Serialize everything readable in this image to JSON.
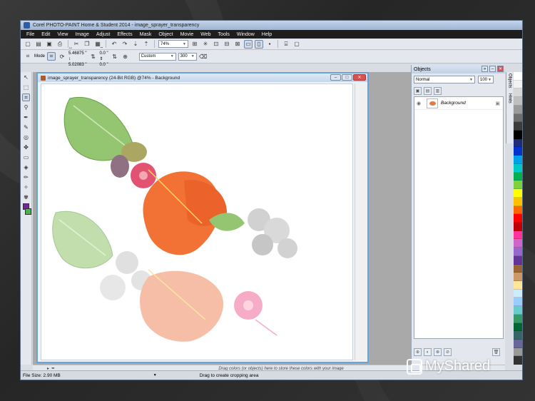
{
  "window": {
    "title": "Corel PHOTO-PAINT Home & Student 2014 - image_sprayer_transparency"
  },
  "menu": [
    "File",
    "Edit",
    "View",
    "Image",
    "Adjust",
    "Effects",
    "Mask",
    "Object",
    "Movie",
    "Web",
    "Tools",
    "Window",
    "Help"
  ],
  "toolbar": {
    "zoom": "74%"
  },
  "property_bar": {
    "mode_label": "Mode",
    "width": "5.46875 \"",
    "height": "5.02083 \"",
    "offset_x": "0.0 \"",
    "offset_y": "0.0 \"",
    "preset": "Custom",
    "resolution": "300"
  },
  "document": {
    "title": "image_sprayer_transparency (24-Bit RGB) @74% - Background"
  },
  "objects_panel": {
    "title": "Objects",
    "blend_mode": "Normal",
    "opacity": "100",
    "items": [
      {
        "name": "Background"
      }
    ]
  },
  "docker_tabs": [
    "Objects",
    "Hints"
  ],
  "color_bar": {
    "hint": "Drag colors (or objects) here to store these colors with your image"
  },
  "status": {
    "file_size": "File Size: 2.90 MB",
    "message": "Drag to create cropping area"
  },
  "watermark": {
    "text": "MyShared"
  },
  "colors": {
    "foreground": "#7a1fa2",
    "background": "#4caf50",
    "palette": [
      "#ffffff",
      "#f2f2f2",
      "#d8d8d8",
      "#bfbfbf",
      "#9a9a9a",
      "#6e6e6e",
      "#3c3c3c",
      "#000000",
      "#1f2a7a",
      "#0033cc",
      "#00a0e9",
      "#00c8c8",
      "#00b050",
      "#7fd13b",
      "#ffff00",
      "#ffc000",
      "#ff6600",
      "#ff0000",
      "#c00000",
      "#ff3399",
      "#cc66cc",
      "#9966cc",
      "#663399",
      "#996633",
      "#cc9966",
      "#ffe699",
      "#ccecff",
      "#99ccff",
      "#66cccc",
      "#339966",
      "#006633",
      "#336666",
      "#666699",
      "#999999",
      "#333333"
    ]
  }
}
